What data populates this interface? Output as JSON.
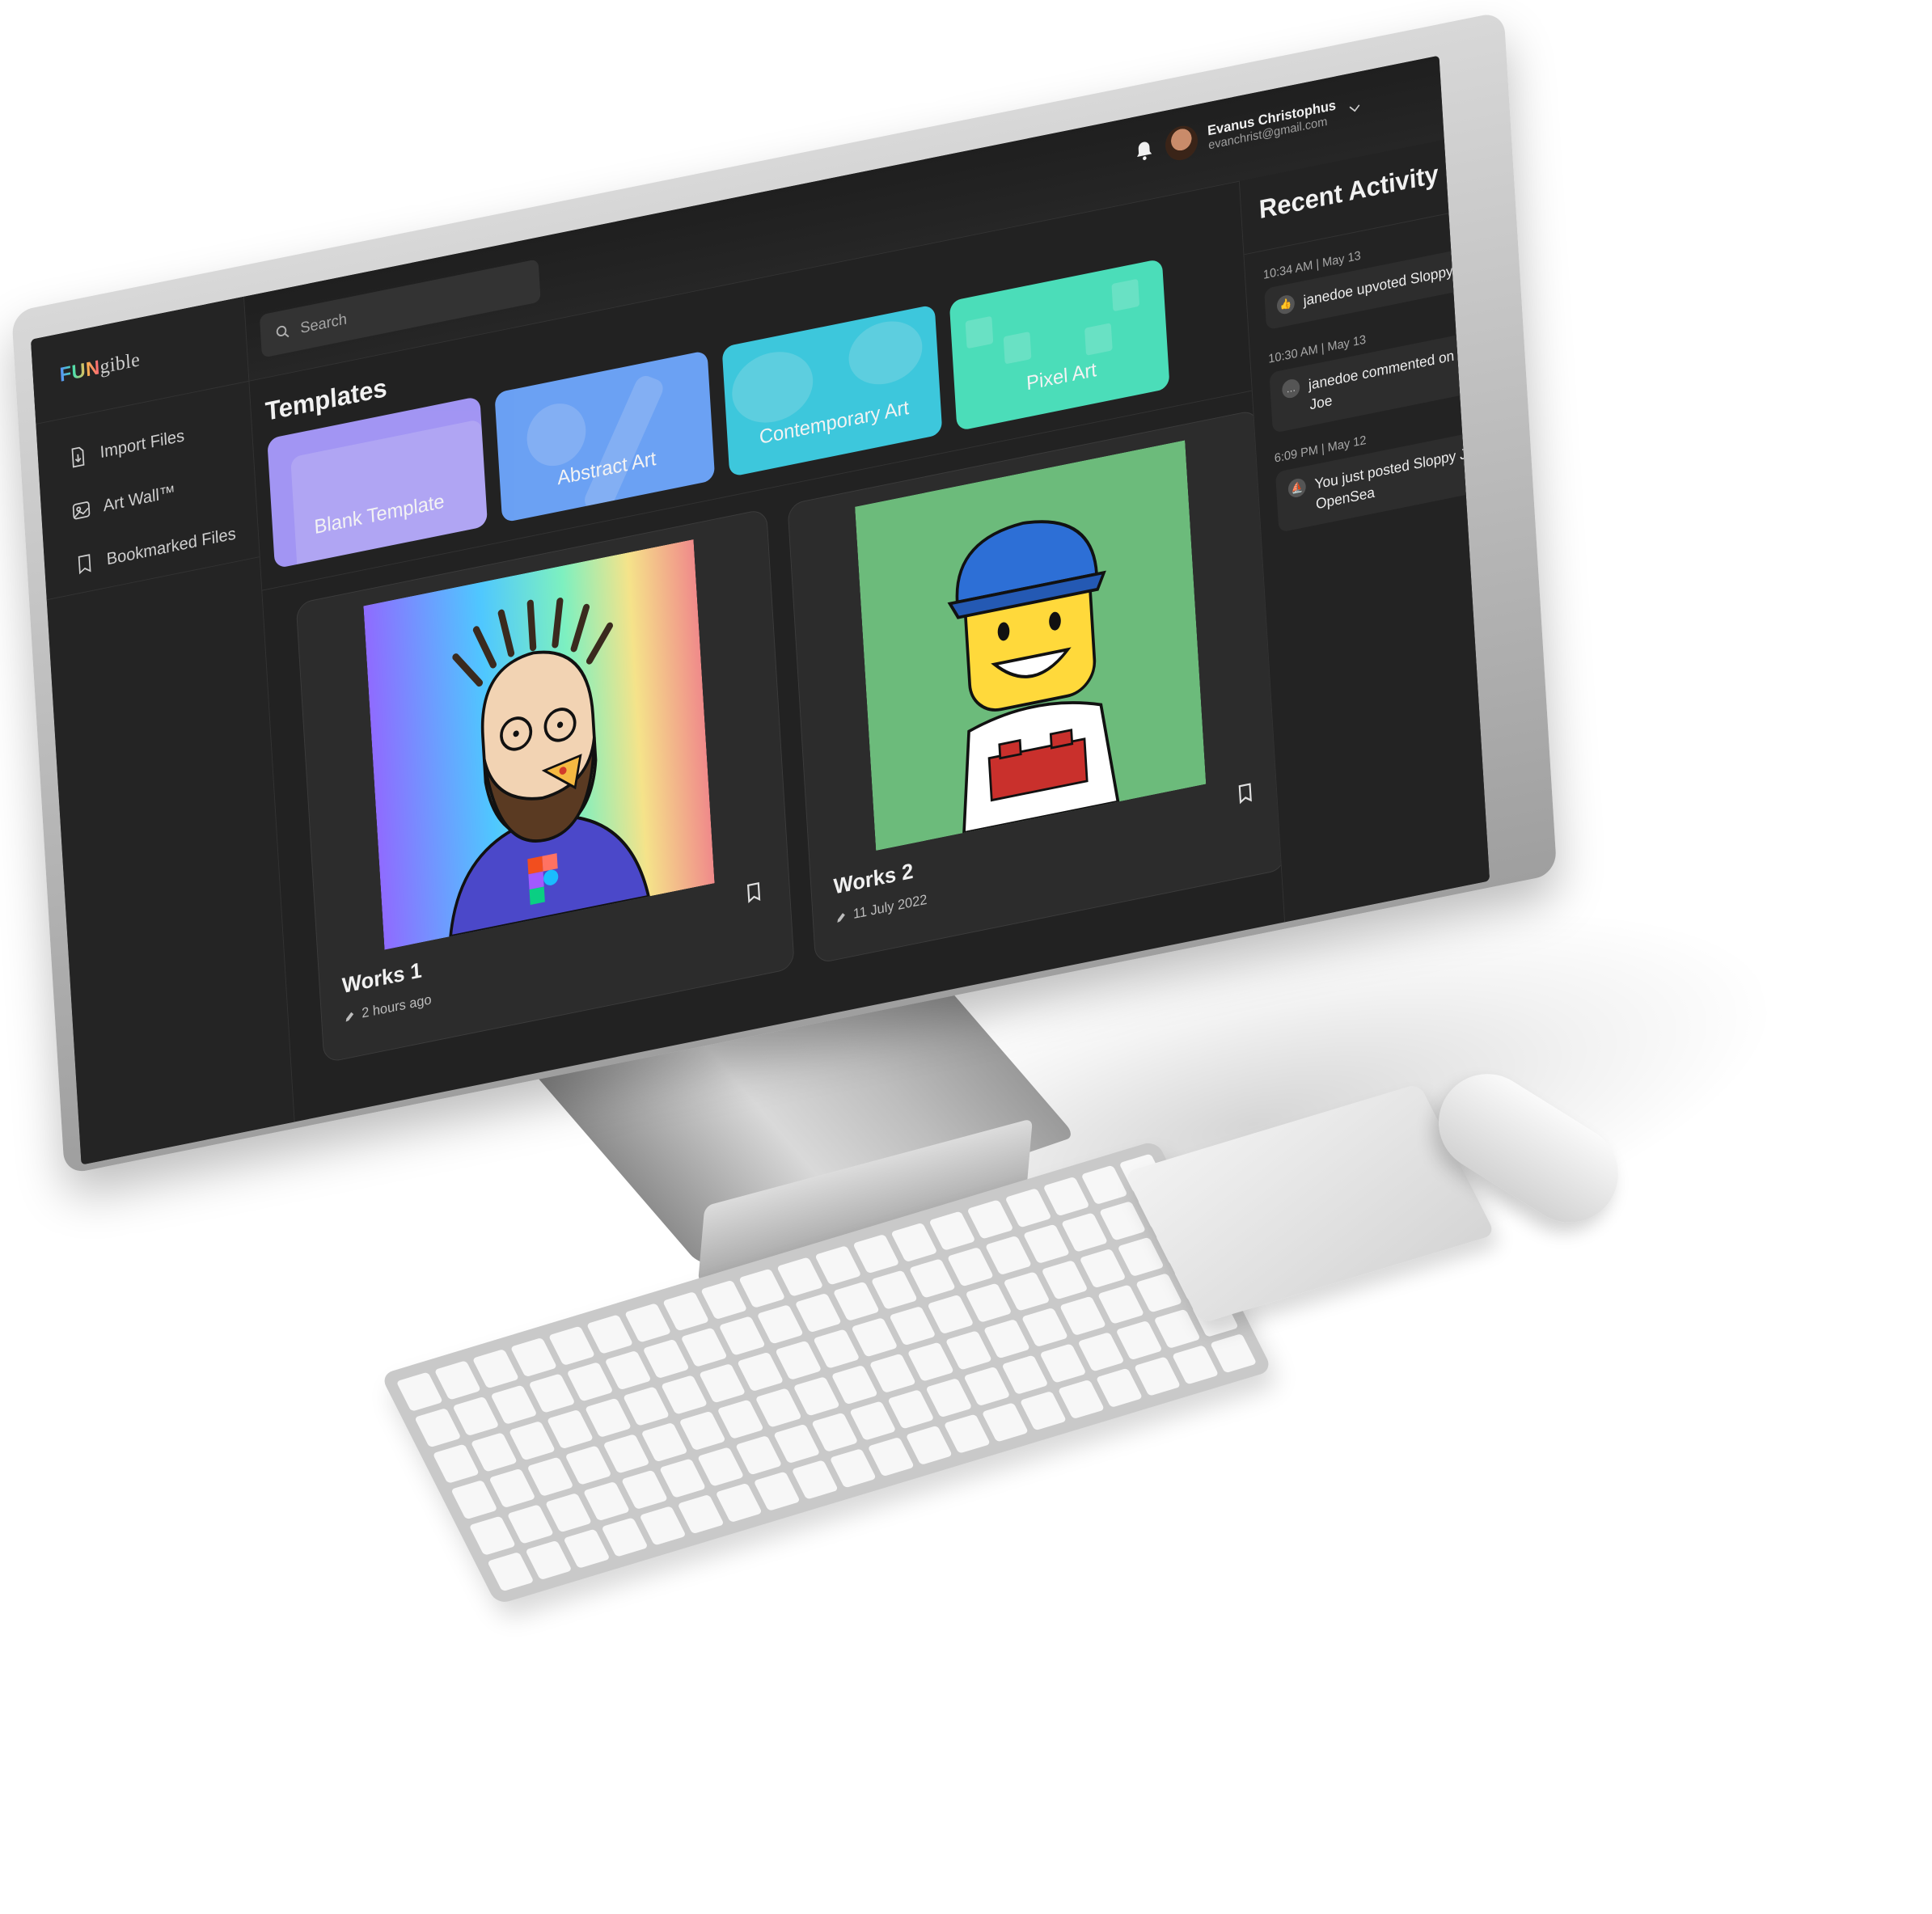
{
  "app": {
    "brand_fun": "FUN",
    "brand_rest": "gible"
  },
  "header": {
    "search_placeholder": "Search",
    "user_name": "Evanus Christophus",
    "user_email": "evanchrist@gmail.com"
  },
  "sidebar": {
    "items": [
      {
        "label": "Import Files",
        "icon": "file-import-icon"
      },
      {
        "label": "Art Wall™",
        "icon": "image-icon"
      },
      {
        "label": "Bookmarked Files",
        "icon": "bookmark-icon"
      }
    ]
  },
  "main": {
    "templates_title": "Templates",
    "templates": [
      {
        "label": "Blank Template",
        "color": "#a99cff"
      },
      {
        "label": "Abstract Art",
        "color": "#6fa8ff"
      },
      {
        "label": "Contemporary Art",
        "color": "#3fd0e6"
      },
      {
        "label": "Pixel Art",
        "color": "#4ee8c2"
      }
    ],
    "works": [
      {
        "title": "Works 1",
        "meta": "2 hours ago"
      },
      {
        "title": "Works 2",
        "meta": "11 July 2022"
      }
    ]
  },
  "activity": {
    "title": "Recent Activity",
    "items": [
      {
        "time": "10:34 AM  |  May 13",
        "text": "janedoe upvoted Sloppy Joe",
        "unread": true,
        "icon": "thumbs-up-icon"
      },
      {
        "time": "10:30 AM  |  May 13",
        "text": "janedoe commented on Sloppy Joe",
        "unread": true,
        "icon": "comment-icon"
      },
      {
        "time": "6:09 PM  |  May 12",
        "text": "You just posted Sloppy Joe to OpenSea",
        "unread": false,
        "icon": "opensea-icon"
      }
    ]
  },
  "colors": {
    "screen_bg": "#222222",
    "accent_unread": "#2b6cff"
  }
}
